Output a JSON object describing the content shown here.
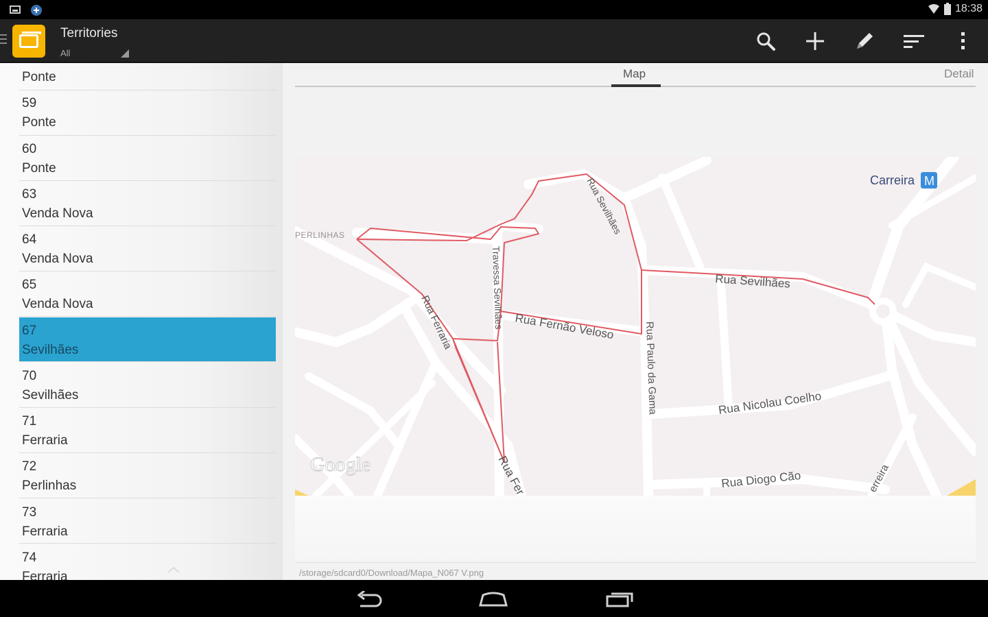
{
  "status_bar": {
    "time": "18:38"
  },
  "action_bar": {
    "title": "Territories",
    "subtitle": "All",
    "actions": [
      "search-icon",
      "add-icon",
      "edit-icon",
      "sort-icon",
      "overflow-menu-icon"
    ]
  },
  "territory_list": [
    {
      "number": "",
      "place": "Ponte"
    },
    {
      "number": "59",
      "place": "Ponte"
    },
    {
      "number": "60",
      "place": "Ponte"
    },
    {
      "number": "63",
      "place": "Venda Nova"
    },
    {
      "number": "64",
      "place": "Venda Nova"
    },
    {
      "number": "65",
      "place": "Venda Nova"
    },
    {
      "number": "67",
      "place": "Sevilhães",
      "selected": true
    },
    {
      "number": "70",
      "place": "Sevilhães"
    },
    {
      "number": "71",
      "place": "Ferraria"
    },
    {
      "number": "72",
      "place": "Perlinhas"
    },
    {
      "number": "73",
      "place": "Ferraria"
    },
    {
      "number": "74",
      "place": "Ferraria"
    }
  ],
  "tabs": {
    "map": "Map",
    "detail": "Detail"
  },
  "map": {
    "labels": {
      "carreira": "Carreira",
      "metro": "M",
      "perlinhas": "PERLINHAS",
      "rua_sevilhaes_top": "Rua Sevilhães",
      "rua_sevilhaes_right": "Rua Sevilhães",
      "travessa": "Travessa Sevilhães",
      "rua_ferraria": "Rua Ferraria",
      "rua_fernao": "Rua Fernão Veloso",
      "rua_paulo": "Rua Paulo da Gama",
      "rua_nicolau": "Rua Nicolau Coelho",
      "rua_diogo": "Rua Diogo Cão",
      "rua_fer_bottom": "Rua Fer",
      "ferreira": "erreira",
      "google": "Google"
    }
  },
  "file_path": "/storage/sdcard0/Download/Mapa_N067 V.png",
  "colors": {
    "selected_bg": "#2aa3d1",
    "app_icon": "#f7b500",
    "route": "#e05a63"
  }
}
